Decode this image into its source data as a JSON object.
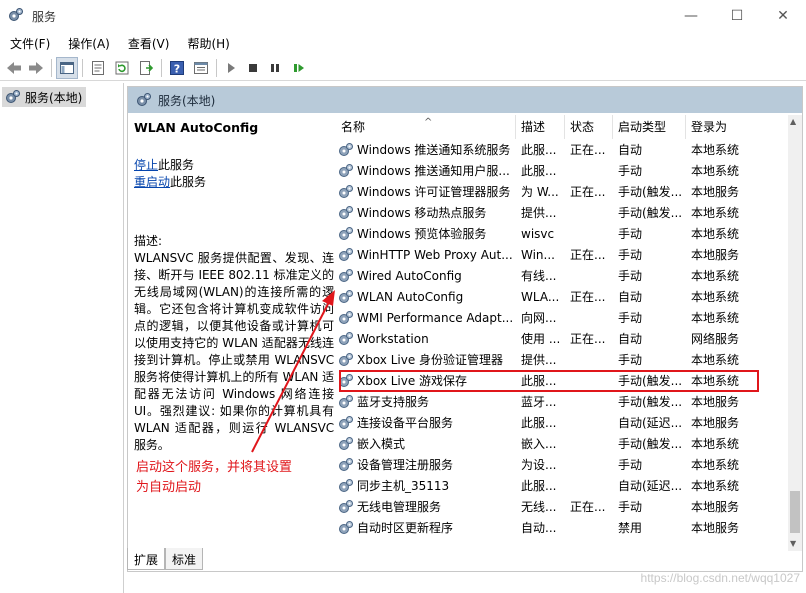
{
  "window": {
    "title": "服务",
    "minimize_glyph": "—",
    "maximize_glyph": "☐",
    "close_glyph": "✕"
  },
  "menu": [
    "文件(F)",
    "操作(A)",
    "查看(V)",
    "帮助(H)"
  ],
  "toolbar": {
    "icons": [
      "back-icon",
      "forward-icon",
      "console-tree-icon",
      "properties-icon",
      "refresh-icon",
      "export-icon",
      "help-icon",
      "view-icon",
      "start-icon",
      "stop-icon",
      "pause-icon",
      "resume-icon"
    ]
  },
  "tree": {
    "root_label": "服务(本地)"
  },
  "main": {
    "header_label": "服务(本地)",
    "detail": {
      "service_title": "WLAN AutoConfig",
      "stop_link": "停止",
      "stop_suffix": "此服务",
      "restart_link": "重启动",
      "restart_suffix": "此服务",
      "desc_heading": "描述:",
      "description": "WLANSVC 服务提供配置、发现、连接、断开与 IEEE 802.11 标准定义的无线局域网(WLAN)的连接所需的逻辑。它还包含将计算机变成软件访问点的逻辑，以便其他设备或计算机可以使用支持它的 WLAN 适配器无线连接到计算机。停止或禁用 WLANSVC 服务将使得计算机上的所有 WLAN 适配器无法访问 Windows 网络连接 UI。强烈建议: 如果你的计算机具有 WLAN 适配器，则运行 WLANSVC 服务。"
    },
    "columns": {
      "name": "名称",
      "desc": "描述",
      "status": "状态",
      "startup": "启动类型",
      "logon": "登录为"
    },
    "services": [
      {
        "name": "Windows 推送通知系统服务",
        "desc": "此服...",
        "status": "正在...",
        "startup": "自动",
        "logon": "本地系统"
      },
      {
        "name": "Windows 推送通知用户服...",
        "desc": "此服...",
        "status": "",
        "startup": "手动",
        "logon": "本地系统"
      },
      {
        "name": "Windows 许可证管理器服务",
        "desc": "为 W...",
        "status": "正在...",
        "startup": "手动(触发...",
        "logon": "本地服务"
      },
      {
        "name": "Windows 移动热点服务",
        "desc": "提供...",
        "status": "",
        "startup": "手动(触发...",
        "logon": "本地系统"
      },
      {
        "name": "Windows 预览体验服务",
        "desc": "wisvc",
        "status": "",
        "startup": "手动",
        "logon": "本地系统"
      },
      {
        "name": "WinHTTP Web Proxy Aut...",
        "desc": "Win...",
        "status": "正在...",
        "startup": "手动",
        "logon": "本地服务"
      },
      {
        "name": "Wired AutoConfig",
        "desc": "有线...",
        "status": "",
        "startup": "手动",
        "logon": "本地系统"
      },
      {
        "name": "WLAN AutoConfig",
        "desc": "WLA...",
        "status": "正在...",
        "startup": "自动",
        "logon": "本地系统"
      },
      {
        "name": "WMI Performance Adapt...",
        "desc": "向网...",
        "status": "",
        "startup": "手动",
        "logon": "本地系统"
      },
      {
        "name": "Workstation",
        "desc": "使用 ...",
        "status": "正在...",
        "startup": "自动",
        "logon": "网络服务"
      },
      {
        "name": "Xbox Live 身份验证管理器",
        "desc": "提供...",
        "status": "",
        "startup": "手动",
        "logon": "本地系统"
      },
      {
        "name": "Xbox Live 游戏保存",
        "desc": "此服...",
        "status": "",
        "startup": "手动(触发...",
        "logon": "本地系统"
      },
      {
        "name": "蓝牙支持服务",
        "desc": "蓝牙...",
        "status": "",
        "startup": "手动(触发...",
        "logon": "本地服务"
      },
      {
        "name": "连接设备平台服务",
        "desc": "此服...",
        "status": "",
        "startup": "自动(延迟...",
        "logon": "本地服务"
      },
      {
        "name": "嵌入模式",
        "desc": "嵌入...",
        "status": "",
        "startup": "手动(触发...",
        "logon": "本地系统"
      },
      {
        "name": "设备管理注册服务",
        "desc": "为设...",
        "status": "",
        "startup": "手动",
        "logon": "本地系统"
      },
      {
        "name": "同步主机_35113",
        "desc": "此服...",
        "status": "",
        "startup": "自动(延迟...",
        "logon": "本地系统"
      },
      {
        "name": "无线电管理服务",
        "desc": "无线...",
        "status": "正在...",
        "startup": "手动",
        "logon": "本地服务"
      },
      {
        "name": "自动时区更新程序",
        "desc": "自动...",
        "status": "",
        "startup": "禁用",
        "logon": "本地服务"
      }
    ]
  },
  "tabs": [
    "扩展",
    "标准"
  ],
  "annotation": {
    "line1": "启动这个服务，并将其设置",
    "line2": "为自动启动",
    "color": "#e0161b"
  },
  "watermark": "https://blog.csdn.net/wqq1027"
}
